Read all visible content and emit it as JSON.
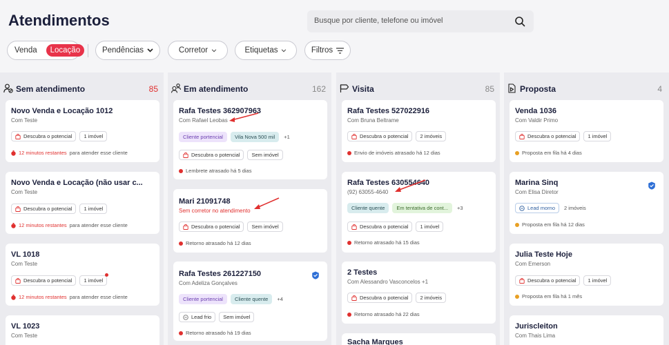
{
  "header": {
    "title": "Atendimentos",
    "search_placeholder": "Busque por cliente, telefone ou imóvel",
    "toggle": {
      "option_a": "Venda",
      "option_b": "Locação"
    },
    "filters": [
      "Pendências",
      "Corretor",
      "Etiquetas",
      "Filtros"
    ]
  },
  "columns": [
    {
      "title": "Sem atendimento",
      "count": "85",
      "count_color": "#e0302f",
      "icon": "user-off-icon",
      "cards": [
        {
          "title": "Novo Venda e Locação 1012",
          "sub": "Com Teste",
          "tags": [
            "Descubra o potencial",
            "1 imóvel"
          ],
          "status_strong": "12 minutos restantes",
          "status": "para atender esse cliente"
        },
        {
          "title": "Novo Venda e Locação (não usar c...",
          "sub": "Com Teste",
          "tags": [
            "Descubra o potencial",
            "1 imóvel"
          ],
          "status_strong": "12 minutos restantes",
          "status": "para atender esse cliente"
        },
        {
          "title": "VL 1018",
          "sub": "Com Teste",
          "tags": [
            "Descubra o potencial",
            "1 imóvel"
          ],
          "status_strong": "12 minutos restantes",
          "status": "para atender esse cliente"
        },
        {
          "title": "VL 1023",
          "sub": "Com Teste"
        }
      ]
    },
    {
      "title": "Em atendimento",
      "count": "162",
      "count_color": "#888888",
      "icon": "users-icon",
      "cards": [
        {
          "title": "Rafa Testes 362907963",
          "sub": "Com Rafael Leobas",
          "labels": [
            "Cliente portencial",
            "Vila Nova 500 mil",
            "+1"
          ],
          "tags": [
            "Descubra o potencial",
            "Sem imóvel"
          ],
          "status": "Lembrete atrasado há 5 dias"
        },
        {
          "title": "Mari 21091748",
          "sub": "Sem corretor no atendimento",
          "tags": [
            "Descubra o potencial",
            "Sem imóvel"
          ],
          "status": "Retorno atrasado há 12 dias"
        },
        {
          "title": "Rafa Testes 261227150",
          "sub": "Com Adeliza Gonçalves",
          "labels": [
            "Cliente portencial",
            "Cliente quente",
            "+4"
          ],
          "tags": [
            "Lead frio",
            "Sem imóvel"
          ],
          "status": "Retorno atrasado há 19 dias"
        }
      ]
    },
    {
      "title": "Visita",
      "count": "85",
      "count_color": "#888888",
      "icon": "flag-icon",
      "cards": [
        {
          "title": "Rafa Testes 527022916",
          "sub": "Com Bruna Beltrame",
          "tags": [
            "Descubra o potencial",
            "2 imóveis"
          ],
          "status": "Envio de imóveis atrasado há 12 dias"
        },
        {
          "title": "Rafa Testes 630554640",
          "sub": "(92) 63055-4640",
          "labels": [
            "Cliente quente",
            "Em tentativa de cont...",
            "+3"
          ],
          "tags": [
            "Descubra o potencial",
            "1 imóvel"
          ],
          "status": "Retorno atrasado há 15 dias"
        },
        {
          "title": "2 Testes",
          "sub": "Com Alessandro Vasconcelos +1",
          "tags": [
            "Descubra o potencial",
            "2 imóveis"
          ],
          "status": "Retorno atrasado há 22 dias"
        },
        {
          "title": "Sacha Marques"
        }
      ]
    },
    {
      "title": "Proposta",
      "count": "4",
      "count_color": "#888888",
      "icon": "document-arrow-icon",
      "cards": [
        {
          "title": "Venda 1036",
          "sub": "Com Valdir Primo",
          "tags": [
            "Descubra o potencial",
            "1 imóvel"
          ],
          "status": "Proposta em fila há 4 dias"
        },
        {
          "title": "Marina Sinq",
          "sub": "Com Elisa Diretor",
          "tags": [
            "Lead morno",
            "2 imóveis"
          ],
          "status": "Proposta em fila há 12 dias"
        },
        {
          "title": "Julia Teste Hoje",
          "sub": "Com Emerson",
          "tags": [
            "Descubra o potencial",
            "1 imóvel"
          ],
          "status": "Proposta em fila há 1 mês"
        },
        {
          "title": "Juriscleiton",
          "sub": "Com Thais Lima"
        }
      ]
    }
  ]
}
